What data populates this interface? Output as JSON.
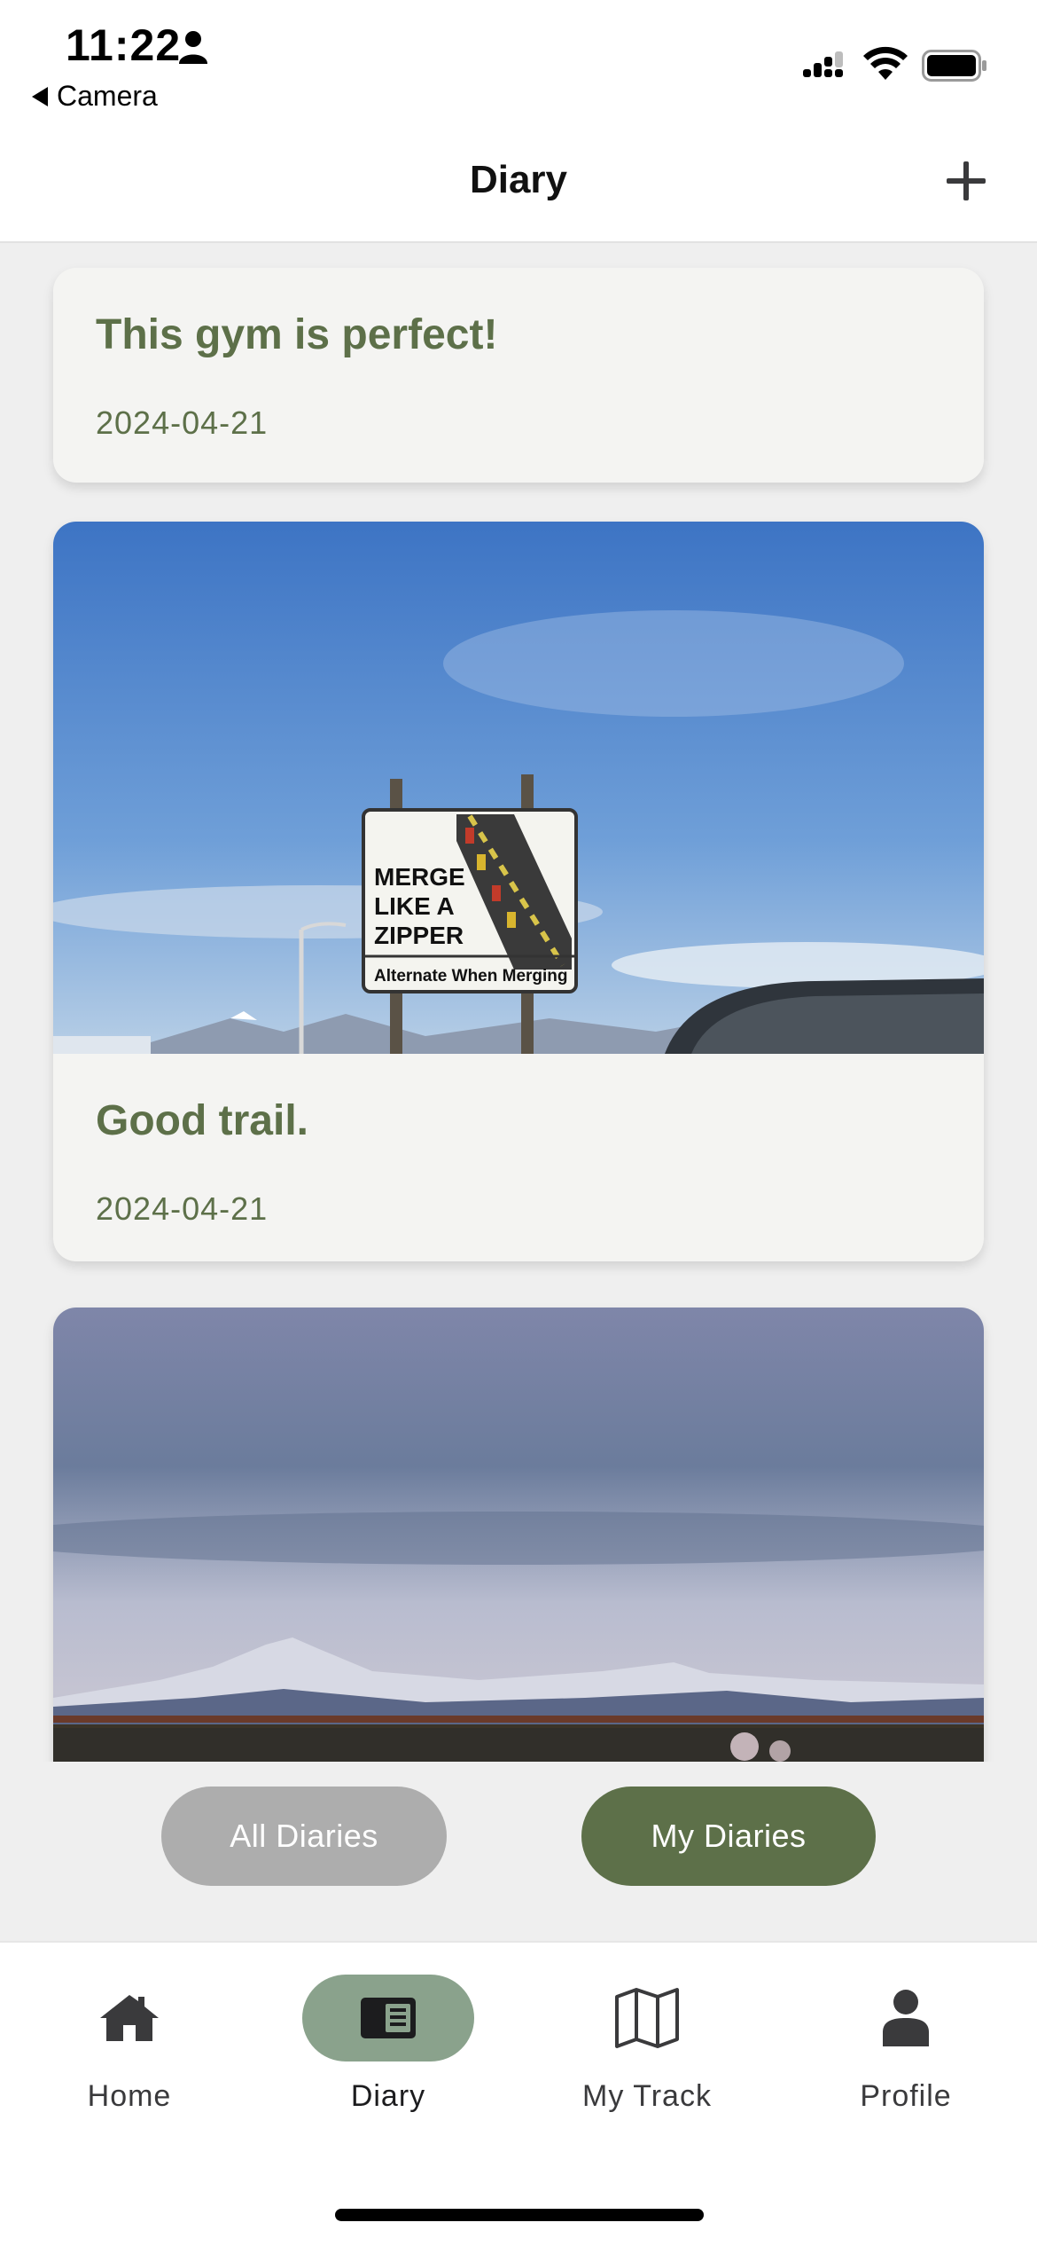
{
  "status_bar": {
    "time": "11:22",
    "back_label": "Camera"
  },
  "header": {
    "title": "Diary",
    "add_icon": "plus-icon"
  },
  "diaries": [
    {
      "title": "This gym is perfect!",
      "date": "2024-04-21",
      "has_image": false
    },
    {
      "title": "Good trail.",
      "date": "2024-04-21",
      "has_image": true,
      "image_sign_text": [
        "MERGE",
        "LIKE A",
        "ZIPPER",
        "Alternate When Merging"
      ]
    },
    {
      "title": "",
      "date": "",
      "has_image": true
    }
  ],
  "segment": {
    "all_label": "All Diaries",
    "my_label": "My Diaries",
    "selected": "My Diaries"
  },
  "tabs": [
    {
      "label": "Home",
      "icon": "home-icon",
      "active": false
    },
    {
      "label": "Diary",
      "icon": "diary-icon",
      "active": true
    },
    {
      "label": "My Track",
      "icon": "map-icon",
      "active": false
    },
    {
      "label": "Profile",
      "icon": "person-icon",
      "active": false
    }
  ],
  "colors": {
    "accent": "#5d7049",
    "accent_light": "#8aa28c",
    "segment_inactive": "#adadad",
    "card_bg": "#f4f4f2",
    "page_bg": "#efefef"
  }
}
